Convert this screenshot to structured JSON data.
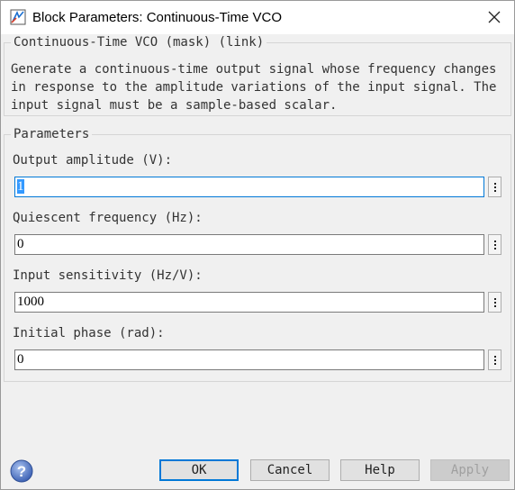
{
  "window": {
    "title": "Block Parameters: Continuous-Time VCO",
    "icon": "simulink-block-icon",
    "close_icon": "close-icon"
  },
  "mask": {
    "legend": "Continuous-Time VCO (mask) (link)",
    "description": "Generate a continuous-time output signal whose frequency changes\nin response to the amplitude variations of the input signal. The\ninput signal must be a sample-based scalar."
  },
  "parameters": {
    "legend": "Parameters",
    "fields": [
      {
        "label": "Output amplitude (V):",
        "value": "1"
      },
      {
        "label": "Quiescent frequency (Hz):",
        "value": "0"
      },
      {
        "label": "Input sensitivity (Hz/V):",
        "value": "1000"
      },
      {
        "label": "Initial phase (rad):",
        "value": "0"
      }
    ]
  },
  "buttons": {
    "ok": "OK",
    "cancel": "Cancel",
    "help": "Help",
    "apply": "Apply"
  },
  "colors": {
    "focus_border": "#0078d7",
    "selection": "#3399ff",
    "help_icon": "#5b7fc7"
  }
}
